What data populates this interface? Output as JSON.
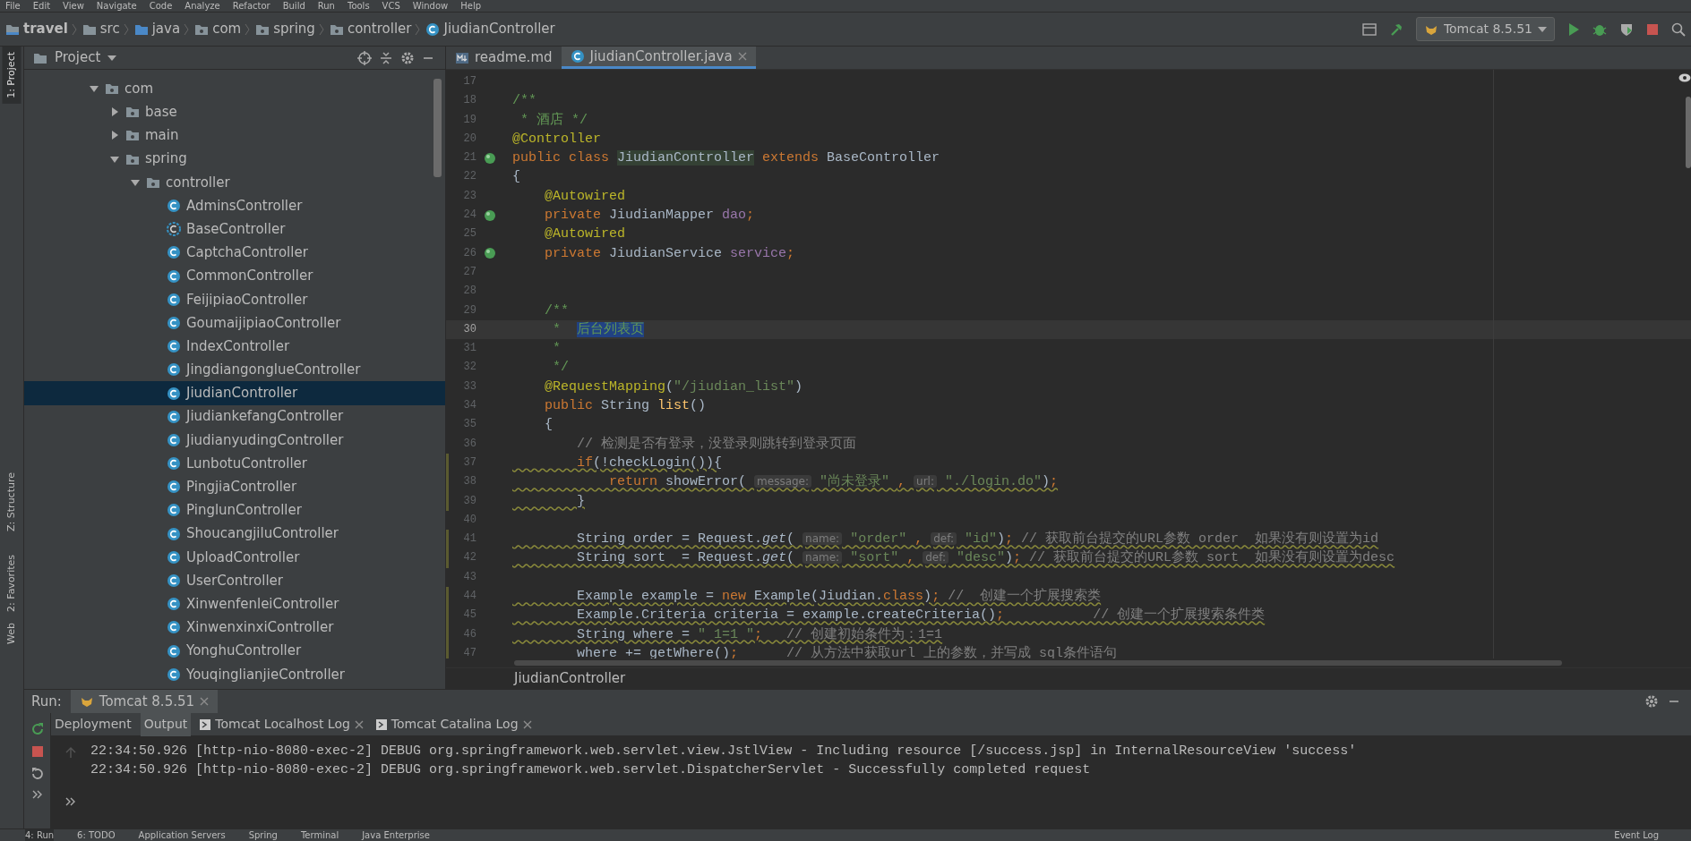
{
  "menu": [
    "File",
    "Edit",
    "View",
    "Navigate",
    "Code",
    "Analyze",
    "Refactor",
    "Build",
    "Run",
    "Tools",
    "VCS",
    "Window",
    "Help"
  ],
  "breadcrumb": [
    {
      "text": "travel",
      "kind": "project"
    },
    {
      "text": "src",
      "kind": "folder"
    },
    {
      "text": "java",
      "kind": "source"
    },
    {
      "text": "com",
      "kind": "package"
    },
    {
      "text": "spring",
      "kind": "package"
    },
    {
      "text": "controller",
      "kind": "package"
    },
    {
      "text": "JiudianController",
      "kind": "class"
    }
  ],
  "run_config": "Tomcat 8.5.51",
  "side_tabs": [
    {
      "label": "1: Project",
      "selected": true
    },
    {
      "label": "Z: Structure",
      "selected": false
    },
    {
      "label": "2: Favorites",
      "selected": false
    },
    {
      "label": "Web",
      "selected": false
    }
  ],
  "project_panel": {
    "title": "Project",
    "tree": [
      {
        "label": "com",
        "kind": "package",
        "expanded": true,
        "selected": false,
        "children": [
          {
            "label": "base",
            "kind": "package",
            "expanded": false,
            "selected": false
          },
          {
            "label": "main",
            "kind": "package",
            "expanded": false,
            "selected": false
          },
          {
            "label": "spring",
            "kind": "package",
            "expanded": true,
            "selected": false,
            "children": [
              {
                "label": "controller",
                "kind": "package",
                "expanded": true,
                "selected": false,
                "children": [
                  {
                    "label": "AdminsController",
                    "kind": "class",
                    "selected": false
                  },
                  {
                    "label": "BaseController",
                    "kind": "abstract",
                    "selected": false
                  },
                  {
                    "label": "CaptchaController",
                    "kind": "class",
                    "selected": false
                  },
                  {
                    "label": "CommonController",
                    "kind": "class",
                    "selected": false
                  },
                  {
                    "label": "FeijipiaoController",
                    "kind": "class",
                    "selected": false
                  },
                  {
                    "label": "GoumaijipiaoController",
                    "kind": "class",
                    "selected": false
                  },
                  {
                    "label": "IndexController",
                    "kind": "class",
                    "selected": false
                  },
                  {
                    "label": "JingdiangonglueController",
                    "kind": "class",
                    "selected": false
                  },
                  {
                    "label": "JiudianController",
                    "kind": "class",
                    "selected": true
                  },
                  {
                    "label": "JiudiankefangController",
                    "kind": "class",
                    "selected": false
                  },
                  {
                    "label": "JiudianyudingController",
                    "kind": "class",
                    "selected": false
                  },
                  {
                    "label": "LunbotuController",
                    "kind": "class",
                    "selected": false
                  },
                  {
                    "label": "PingjiaController",
                    "kind": "class",
                    "selected": false
                  },
                  {
                    "label": "PinglunController",
                    "kind": "class",
                    "selected": false
                  },
                  {
                    "label": "ShoucangjiluController",
                    "kind": "class",
                    "selected": false
                  },
                  {
                    "label": "UploadController",
                    "kind": "class",
                    "selected": false
                  },
                  {
                    "label": "UserController",
                    "kind": "class",
                    "selected": false
                  },
                  {
                    "label": "XinwenfenleiController",
                    "kind": "class",
                    "selected": false
                  },
                  {
                    "label": "XinwenxinxiController",
                    "kind": "class",
                    "selected": false
                  },
                  {
                    "label": "YonghuController",
                    "kind": "class",
                    "selected": false
                  },
                  {
                    "label": "YouqinglianjieController",
                    "kind": "class",
                    "selected": false
                  }
                ]
              }
            ]
          }
        ]
      }
    ]
  },
  "editor": {
    "tabs": [
      {
        "label": "readme.md",
        "kind": "markdown",
        "selected": false,
        "closable": false
      },
      {
        "label": "JiudianController.java",
        "kind": "class",
        "selected": true,
        "closable": true
      }
    ],
    "lines": [
      {
        "number": "17",
        "current": false,
        "warning": false,
        "bean": false
      },
      {
        "number": "18",
        "current": false,
        "warning": false,
        "bean": false,
        "tokens": [
          {
            "kind": "doc",
            "text": "/**"
          }
        ]
      },
      {
        "number": "19",
        "current": false,
        "warning": false,
        "bean": false,
        "tokens": [
          {
            "kind": "doc",
            "text": " * 酒店 */"
          }
        ]
      },
      {
        "number": "20",
        "current": false,
        "warning": false,
        "bean": false,
        "tokens": [
          {
            "kind": "annotation",
            "text": "@Controller"
          }
        ]
      },
      {
        "number": "21",
        "current": false,
        "warning": false,
        "bean": true,
        "tokens": [
          {
            "kind": "keyword",
            "text": "public class "
          },
          {
            "kind": "declaration",
            "text": "JiudianController"
          },
          {
            "kind": "keyword",
            "text": " extends "
          },
          {
            "kind": "plain",
            "text": "BaseController"
          }
        ]
      },
      {
        "number": "22",
        "current": false,
        "warning": false,
        "bean": false,
        "tokens": [
          {
            "kind": "plain",
            "text": "{"
          }
        ]
      },
      {
        "number": "23",
        "current": false,
        "warning": false,
        "bean": false,
        "tokens": [
          {
            "kind": "annotation",
            "text": "    @Autowired"
          }
        ]
      },
      {
        "number": "24",
        "current": false,
        "warning": false,
        "bean": true,
        "tokens": [
          {
            "kind": "keyword",
            "text": "    private "
          },
          {
            "kind": "plain",
            "text": "JiudianMapper "
          },
          {
            "kind": "field",
            "text": "dao"
          },
          {
            "kind": "keyword",
            "text": ";"
          }
        ]
      },
      {
        "number": "25",
        "current": false,
        "warning": false,
        "bean": false,
        "tokens": [
          {
            "kind": "annotation",
            "text": "    @Autowired"
          }
        ]
      },
      {
        "number": "26",
        "current": false,
        "warning": false,
        "bean": true,
        "tokens": [
          {
            "kind": "keyword",
            "text": "    private "
          },
          {
            "kind": "plain",
            "text": "JiudianService "
          },
          {
            "kind": "field",
            "text": "service"
          },
          {
            "kind": "keyword",
            "text": ";"
          }
        ]
      },
      {
        "number": "27",
        "current": false,
        "warning": false,
        "bean": false
      },
      {
        "number": "28",
        "current": false,
        "warning": false,
        "bean": false
      },
      {
        "number": "29",
        "current": false,
        "warning": false,
        "bean": false,
        "tokens": [
          {
            "kind": "doc",
            "text": "    /**"
          }
        ]
      },
      {
        "number": "30",
        "current": true,
        "warning": false,
        "bean": false,
        "tokens": [
          {
            "kind": "doc",
            "text": "     *  "
          },
          {
            "kind": "selection",
            "text": "后台列表页"
          }
        ]
      },
      {
        "number": "31",
        "current": false,
        "warning": false,
        "bean": false,
        "tokens": [
          {
            "kind": "doc",
            "text": "     *"
          }
        ]
      },
      {
        "number": "32",
        "current": false,
        "warning": false,
        "bean": false,
        "tokens": [
          {
            "kind": "doc",
            "text": "     */"
          }
        ]
      },
      {
        "number": "33",
        "current": false,
        "warning": false,
        "bean": false,
        "tokens": [
          {
            "kind": "annotation",
            "text": "    @RequestMapping"
          },
          {
            "kind": "plain",
            "text": "("
          },
          {
            "kind": "string",
            "text": "\"/jiudian_list\""
          },
          {
            "kind": "plain",
            "text": ")"
          }
        ]
      },
      {
        "number": "34",
        "current": false,
        "warning": false,
        "bean": false,
        "tokens": [
          {
            "kind": "keyword",
            "text": "    public "
          },
          {
            "kind": "plain",
            "text": "String "
          },
          {
            "kind": "method",
            "text": "list"
          },
          {
            "kind": "plain",
            "text": "()"
          }
        ]
      },
      {
        "number": "35",
        "current": false,
        "warning": false,
        "bean": false,
        "tokens": [
          {
            "kind": "plain",
            "text": "    {"
          }
        ]
      },
      {
        "number": "36",
        "current": false,
        "warning": false,
        "bean": false,
        "tokens": [
          {
            "kind": "comment",
            "text": "        // 检测是否有登录，没登录则跳转到登录页面"
          }
        ]
      },
      {
        "number": "37",
        "current": false,
        "warning": true,
        "bean": false,
        "tokens": [
          {
            "kind": "keyword",
            "text": "        if"
          },
          {
            "kind": "plain",
            "text": "(!checkLogin()){"
          }
        ]
      },
      {
        "number": "38",
        "current": false,
        "warning": true,
        "bean": false,
        "tokens": [
          {
            "kind": "keyword",
            "text": "            return "
          },
          {
            "kind": "plain",
            "text": "showError( "
          },
          {
            "kind": "hint",
            "text": "message:"
          },
          {
            "kind": "string",
            "text": " \"尚未登录\" "
          },
          {
            "kind": "keyword",
            "text": ", "
          },
          {
            "kind": "hint",
            "text": "url:"
          },
          {
            "kind": "string",
            "text": " \"./login.do\""
          },
          {
            "kind": "plain",
            "text": ")"
          },
          {
            "kind": "keyword",
            "text": ";"
          }
        ]
      },
      {
        "number": "39",
        "current": false,
        "warning": true,
        "bean": false,
        "tokens": [
          {
            "kind": "plain",
            "text": "        }"
          }
        ]
      },
      {
        "number": "40",
        "current": false,
        "warning": false,
        "bean": false
      },
      {
        "number": "41",
        "current": false,
        "warning": true,
        "bean": false,
        "tokens": [
          {
            "kind": "plain",
            "text": "        String order = Request."
          },
          {
            "kind": "static",
            "text": "get"
          },
          {
            "kind": "plain",
            "text": "( "
          },
          {
            "kind": "hint",
            "text": "name:"
          },
          {
            "kind": "string",
            "text": " \"order\" "
          },
          {
            "kind": "keyword",
            "text": ", "
          },
          {
            "kind": "hint",
            "text": "def:"
          },
          {
            "kind": "string",
            "text": " \"id\""
          },
          {
            "kind": "plain",
            "text": ")"
          },
          {
            "kind": "keyword",
            "text": ";"
          },
          {
            "kind": "comment",
            "text": " // 获取前台提交的URL参数 order  如果没有则设置为id"
          }
        ]
      },
      {
        "number": "42",
        "current": false,
        "warning": true,
        "bean": false,
        "tokens": [
          {
            "kind": "plain",
            "text": "        String sort  = Request."
          },
          {
            "kind": "static",
            "text": "get"
          },
          {
            "kind": "plain",
            "text": "( "
          },
          {
            "kind": "hint",
            "text": "name:"
          },
          {
            "kind": "string",
            "text": " \"sort\" "
          },
          {
            "kind": "keyword",
            "text": ", "
          },
          {
            "kind": "hint",
            "text": "def:"
          },
          {
            "kind": "string",
            "text": " \"desc\""
          },
          {
            "kind": "plain",
            "text": ")"
          },
          {
            "kind": "keyword",
            "text": ";"
          },
          {
            "kind": "comment",
            "text": " // 获取前台提交的URL参数 sort  如果没有则设置为desc"
          }
        ]
      },
      {
        "number": "43",
        "current": false,
        "warning": false,
        "bean": false
      },
      {
        "number": "44",
        "current": false,
        "warning": true,
        "bean": false,
        "tokens": [
          {
            "kind": "plain",
            "text": "        Example example = "
          },
          {
            "kind": "keyword",
            "text": "new "
          },
          {
            "kind": "plain",
            "text": "Example(Jiudian."
          },
          {
            "kind": "keyword",
            "text": "class"
          },
          {
            "kind": "plain",
            "text": ")"
          },
          {
            "kind": "keyword",
            "text": ";"
          },
          {
            "kind": "comment",
            "text": " //  创建一个扩展搜索类"
          }
        ]
      },
      {
        "number": "45",
        "current": false,
        "warning": true,
        "bean": false,
        "tokens": [
          {
            "kind": "plain",
            "text": "        Example.Criteria criteria = example.createCriteria()"
          },
          {
            "kind": "keyword",
            "text": ";"
          },
          {
            "kind": "comment",
            "text": "           // 创建一个扩展搜索条件类"
          }
        ]
      },
      {
        "number": "46",
        "current": false,
        "warning": true,
        "bean": false,
        "tokens": [
          {
            "kind": "plain",
            "text": "        String where = "
          },
          {
            "kind": "string",
            "text": "\" 1=1 \""
          },
          {
            "kind": "keyword",
            "text": ";"
          },
          {
            "kind": "comment",
            "text": "   // 创建初始条件为：1=1"
          }
        ]
      },
      {
        "number": "47",
        "current": false,
        "warning": true,
        "bean": false,
        "tokens": [
          {
            "kind": "plain",
            "text": "        where += getWhere()"
          },
          {
            "kind": "keyword",
            "text": ";"
          },
          {
            "kind": "comment",
            "text": "      // 从方法中获取url 上的参数，并写成 sql条件语句"
          }
        ]
      }
    ],
    "breadcrumb": "JiudianController"
  },
  "run_panel": {
    "title": "Run:",
    "tab": "Tomcat 8.5.51",
    "subtabs": [
      {
        "label": "Deployment",
        "selected": false,
        "closable": false
      },
      {
        "label": "Output",
        "selected": true,
        "closable": false
      },
      {
        "label": "Tomcat Localhost Log",
        "selected": false,
        "closable": true
      },
      {
        "label": "Tomcat Catalina Log",
        "selected": false,
        "closable": true
      }
    ],
    "console": [
      "22:34:50.926 [http-nio-8080-exec-2] DEBUG org.springframework.web.servlet.view.JstlView - Including resource [/success.jsp] in InternalResourceView 'success'",
      "22:34:50.926 [http-nio-8080-exec-2] DEBUG org.springframework.web.servlet.DispatcherServlet - Successfully completed request"
    ]
  },
  "bottom_bar": [
    {
      "label": "4: Run",
      "selected": true
    },
    {
      "label": "6: TODO",
      "selected": false
    },
    {
      "label": "Application Servers",
      "selected": false
    },
    {
      "label": "Spring",
      "selected": false
    },
    {
      "label": "Terminal",
      "selected": false
    },
    {
      "label": "Java Enterprise",
      "selected": false
    },
    {
      "label": "Event Log",
      "selected": false
    }
  ]
}
